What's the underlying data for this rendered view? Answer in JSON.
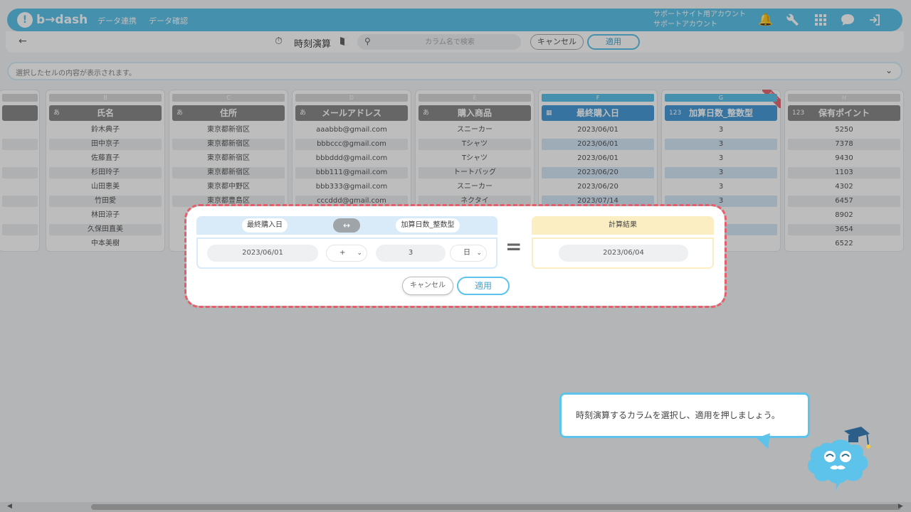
{
  "app": {
    "logo": "b→dash",
    "nav": [
      "データ連携",
      "データ確認"
    ],
    "account_line1": "サポートサイト用アカウント",
    "account_line2": "サポートアカウント",
    "header_icons": [
      "bell-icon",
      "wrench-icon",
      "apps-grid-icon",
      "chat-icon",
      "logout-icon"
    ]
  },
  "toolbar": {
    "back_label": "←",
    "title": "時刻演算",
    "search_placeholder": "カラム名で検索",
    "cancel_label": "キャンセル",
    "apply_label": "適用"
  },
  "cell_display": {
    "text": "選択したセルの内容が表示されます。"
  },
  "columns": [
    {
      "letter": "B",
      "name": "氏名",
      "type": "あ",
      "values": [
        "鈴木典子",
        "田中京子",
        "佐藤直子",
        "杉田玲子",
        "山田恵美",
        "竹田愛",
        "林田涼子",
        "久保田直美",
        "中本美樹"
      ]
    },
    {
      "letter": "C",
      "name": "住所",
      "type": "あ",
      "values": [
        "東京都新宿区",
        "東京都新宿区",
        "東京都新宿区",
        "東京都新宿区",
        "東京都中野区",
        "東京都豊島区"
      ]
    },
    {
      "letter": "D",
      "name": "メールアドレス",
      "type": "あ",
      "values": [
        "aaabbb@gmail.com",
        "bbbccc@gmail.com",
        "bbbddd@gmail.com",
        "bbb111@gmail.com",
        "bbb333@gmail.com",
        "cccddd@gmail.com"
      ]
    },
    {
      "letter": "E",
      "name": "購入商品",
      "type": "あ",
      "values": [
        "スニーカー",
        "Tシャツ",
        "Tシャツ",
        "トートバッグ",
        "スニーカー",
        "ネクタイ"
      ]
    },
    {
      "letter": "F",
      "name": "最終購入日",
      "type": "cal",
      "values": [
        "2023/06/01",
        "2023/06/01",
        "2023/06/01",
        "2023/06/20",
        "2023/06/20",
        "2023/07/14"
      ]
    },
    {
      "letter": "G",
      "name": "加算日数_整数型",
      "type": "123",
      "badge": "NEW",
      "values": [
        "3",
        "3",
        "3",
        "3",
        "3",
        "3"
      ]
    },
    {
      "letter": "H",
      "name": "保有ポイント",
      "type": "123",
      "values": [
        "5250",
        "7378",
        "9430",
        "1103",
        "4302",
        "6457",
        "8902",
        "3654",
        "6522"
      ]
    }
  ],
  "modal": {
    "left_label": "最終購入日",
    "swap_icon": "↔",
    "right_label": "加算日数_整数型",
    "date_value": "2023/06/01",
    "operator": "+",
    "number_value": "3",
    "unit": "日",
    "equals": "=",
    "result_label": "計算結果",
    "result_value": "2023/06/04",
    "cancel_label": "キャンセル",
    "apply_label": "適用"
  },
  "tooltip": {
    "text": "時刻演算するカラムを選択し、適用を押しましょう。"
  },
  "colors": {
    "accent": "#5ec3ea",
    "highlight_header": "#4a9cd8",
    "dashed_outline": "#e65e6a",
    "result_bg": "#fbeec3"
  }
}
